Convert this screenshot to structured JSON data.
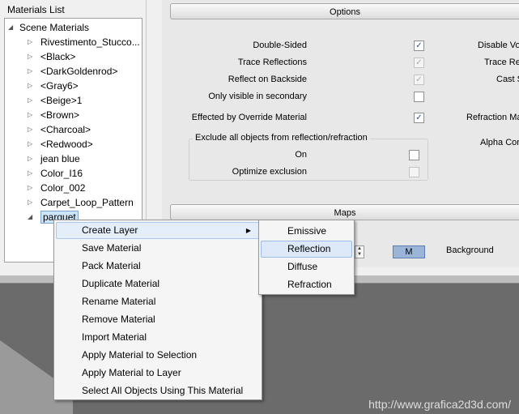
{
  "materials_panel": {
    "title": "Materials List",
    "root": "Scene Materials",
    "items": [
      "Rivestimento_Stucco...",
      "<Black>",
      "<DarkGoldenrod>",
      "<Gray6>",
      "<Beige>1",
      "<Brown>",
      "<Charcoal>",
      "<Redwood>",
      "jean blue",
      "Color_I16",
      "Color_002",
      "Carpet_Loop_Pattern",
      "parquet"
    ]
  },
  "options_panel": {
    "section_title": "Options",
    "rows": [
      {
        "label": "Double-Sided",
        "checked": "✓"
      },
      {
        "label": "Trace Reflections",
        "checked": "✓"
      },
      {
        "label": "Reflect on Backside",
        "checked": "✓"
      },
      {
        "label": "Only visible in secondary",
        "checked": ""
      },
      {
        "label": "Effected by Override Material",
        "checked": "✓"
      }
    ],
    "right_cut_labels": [
      "Disable Vol",
      "Trace Re",
      "Cast S",
      "Refraction Ma",
      "Alpha Con"
    ],
    "exclude_group": {
      "title": "Exclude all objects from reflection/refraction",
      "on_label": "On",
      "optimize_label": "Optimize exclusion"
    }
  },
  "maps_panel": {
    "section_title": "Maps",
    "m_button": "M",
    "background_label": "Background"
  },
  "context_menu": {
    "items": [
      "Create Layer",
      "Save Material",
      "Pack Material",
      "Duplicate Material",
      "Rename Material",
      "Remove Material",
      "Import Material",
      "Apply Material to Selection",
      "Apply Material to Layer",
      "Select All Objects Using This Material"
    ],
    "submenu_arrow": "▶"
  },
  "submenu": {
    "items": [
      "Emissive",
      "Reflection",
      "Diffuse",
      "Refraction"
    ]
  },
  "watermark": "http://www.grafica2d3d.com/"
}
